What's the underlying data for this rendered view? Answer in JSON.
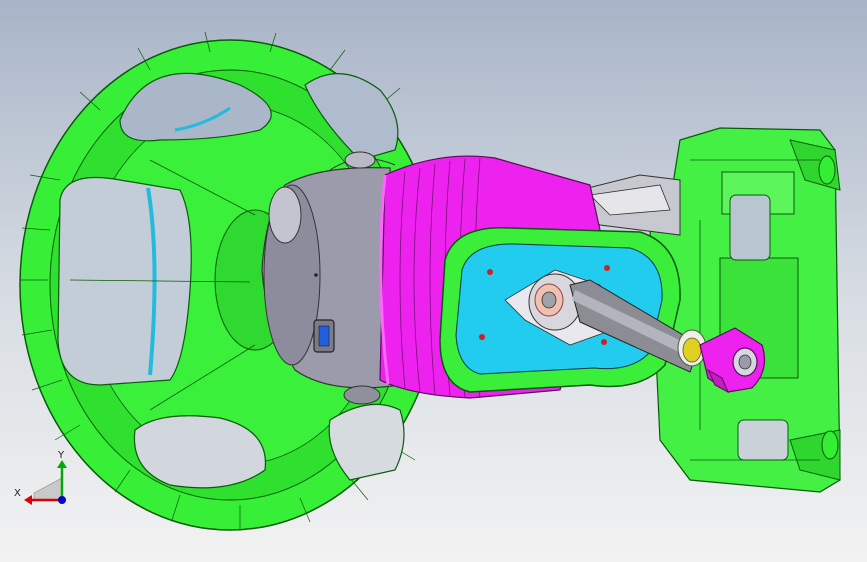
{
  "viewport": {
    "background_top": "#a8b4c7",
    "background_bottom": "#f2f2f2"
  },
  "model": {
    "parts": [
      {
        "name": "steering-wheel",
        "color": "#33ee33"
      },
      {
        "name": "column-housing",
        "color": "#9a9aa8"
      },
      {
        "name": "column-cover",
        "color": "#ee22ee"
      },
      {
        "name": "mounting-plate",
        "color": "#33ee33"
      },
      {
        "name": "plate-insert",
        "color": "#22ccee"
      },
      {
        "name": "intermediate-shaft",
        "color": "#8c8c94"
      },
      {
        "name": "mounting-bracket",
        "color": "#33ee33"
      },
      {
        "name": "universal-joint-yoke",
        "color": "#ee22ee"
      }
    ]
  },
  "triad": {
    "x_label": "X",
    "y_label": "Y",
    "x_color": "#dd0000",
    "y_color": "#00aa00",
    "z_color": "#0000cc"
  }
}
